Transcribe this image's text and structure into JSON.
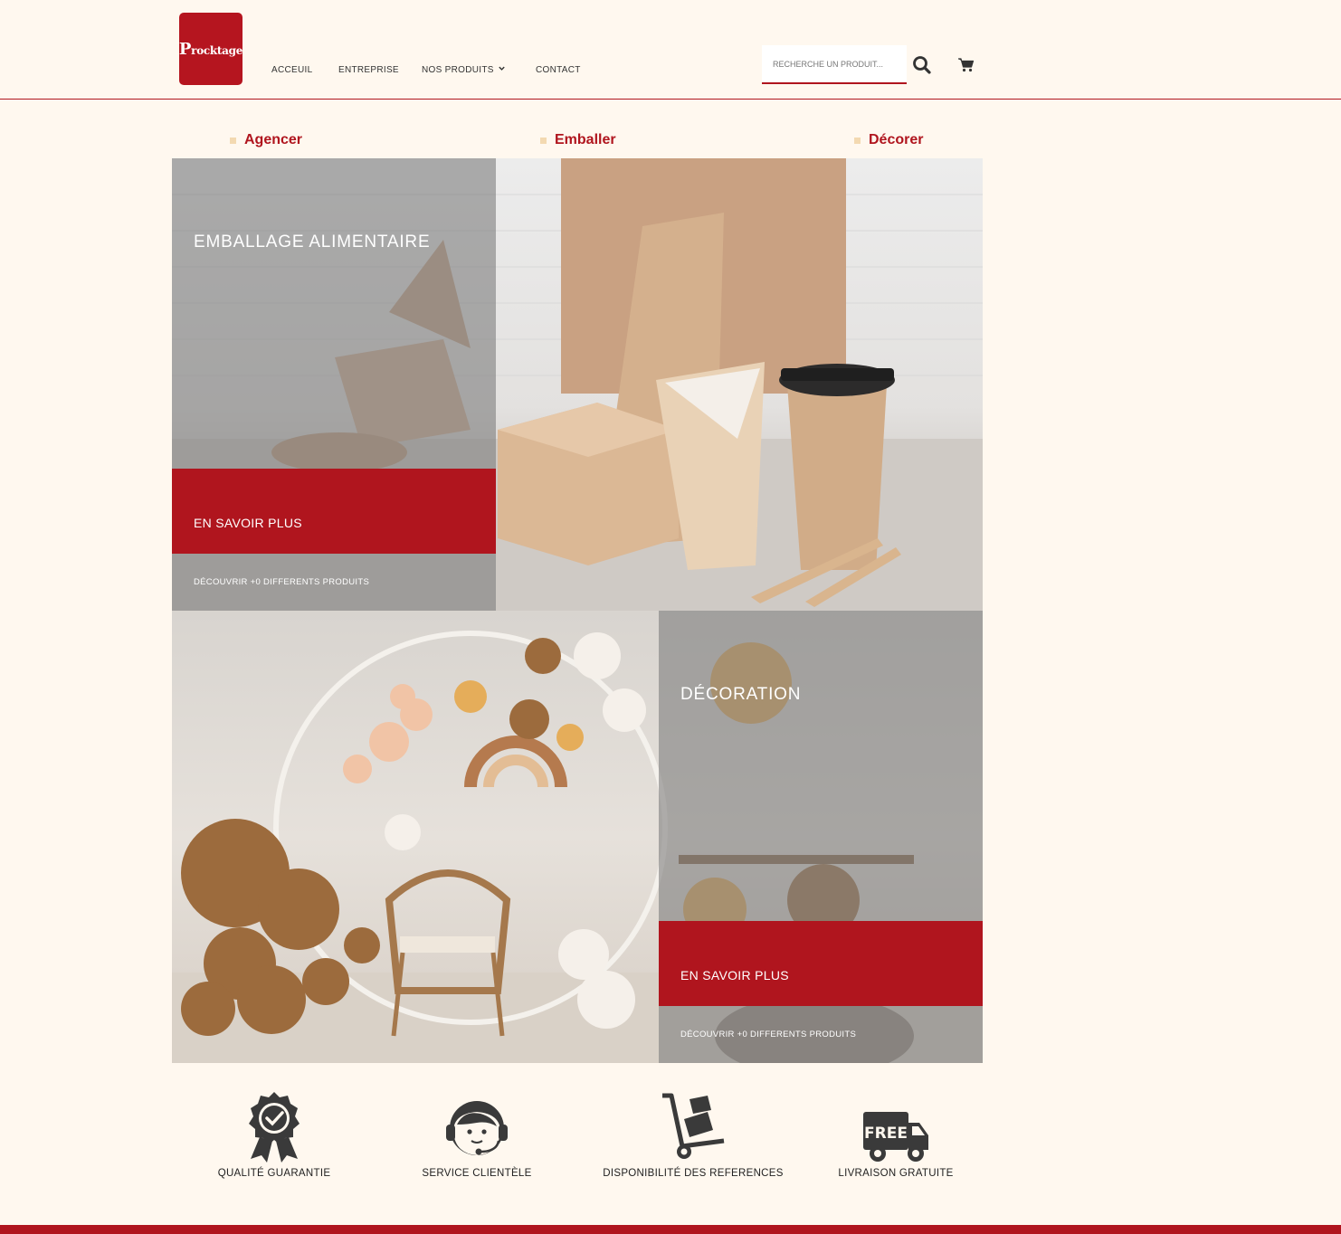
{
  "header": {
    "logo_text_cap": "P",
    "logo_text_rest": "rocktage",
    "nav": {
      "accueil": "ACCEUIL",
      "entreprise": "ENTREPRISE",
      "produits": "NOS PRODUITS",
      "contact": "CONTACT"
    },
    "search": {
      "placeholder": "RECHERCHE UN PRODUIT...",
      "value": ""
    }
  },
  "categories": [
    "Agencer",
    "Emballer",
    "Décorer"
  ],
  "tiles": [
    {
      "title": "EMBALLAGE ALIMENTAIRE",
      "cta": "EN SAVOIR PLUS",
      "subtitle": "DÉCOUVRIR +0 DIFFERENTS PRODUITS"
    },
    {
      "title": "DÉCORATION",
      "cta": "EN SAVOIR PLUS",
      "subtitle": "DÉCOUVRIR +0 DIFFERENTS PRODUITS"
    }
  ],
  "features": [
    {
      "label": "QUALITÉ GUARANTIE",
      "icon": "award-badge-icon"
    },
    {
      "label": "SERVICE CLIENTÈLE",
      "icon": "headset-agent-icon"
    },
    {
      "label": "DISPONIBILITÉ DES REFERENCES",
      "icon": "hand-truck-icon"
    },
    {
      "label": "LIVRAISON GRATUITE",
      "icon": "free-delivery-truck-icon"
    }
  ],
  "colors": {
    "brand_red": "#b0151e",
    "background": "#fff8ef",
    "accent_beige": "#f3d9b1",
    "icon_dark": "#3a3a3a"
  }
}
